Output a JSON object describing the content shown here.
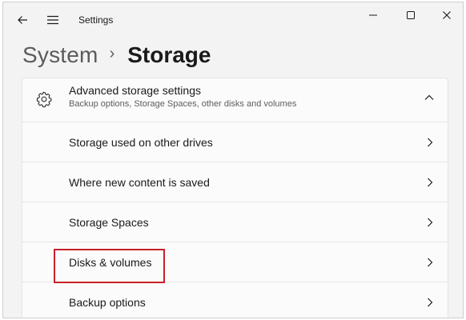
{
  "window": {
    "title": "Settings",
    "controls": {
      "back_icon": "back-arrow-icon",
      "menu_icon": "hamburger-menu-icon"
    }
  },
  "breadcrumb": {
    "parent": "System",
    "separator": "›",
    "current": "Storage"
  },
  "advanced": {
    "title": "Advanced storage settings",
    "subtitle": "Backup options, Storage Spaces, other disks and volumes",
    "icon": "gear-icon",
    "expanded": true
  },
  "items": [
    {
      "label": "Storage used on other drives"
    },
    {
      "label": "Where new content is saved"
    },
    {
      "label": "Storage Spaces"
    },
    {
      "label": "Disks & volumes",
      "highlighted": true
    },
    {
      "label": "Backup options"
    }
  ],
  "colors": {
    "highlight": "#c8202a",
    "background": "#f3f3f3",
    "card": "#fbfbfb"
  }
}
